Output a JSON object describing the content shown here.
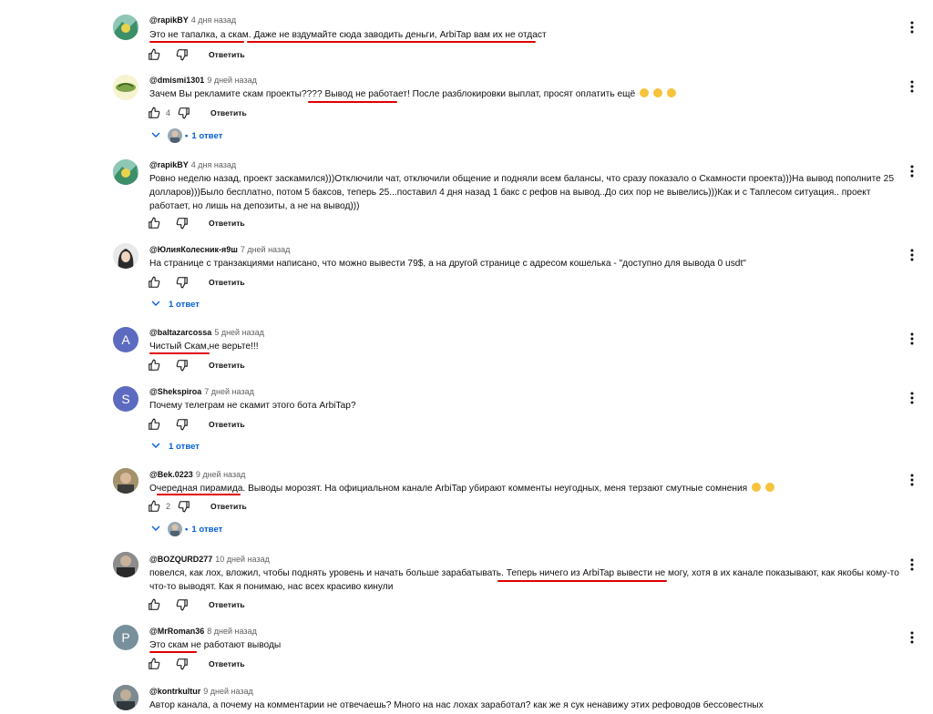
{
  "ui": {
    "reply_label": "Ответить"
  },
  "comments": [
    {
      "author": "@rapikBY",
      "time": "4 дня назад",
      "text": "Это не тапалка, а скам. Даже не вздумайте сюда заводить деньги, ArbiTap вам их не отдаст",
      "likes": "",
      "replies": ""
    },
    {
      "author": "@dmismi1301",
      "time": "9 дней назад",
      "text": "Зачем Вы рекламите скам проекты???? Вывод не работает! После разблокировки выплат, просят оплатить ещё",
      "likes": "4",
      "replies": "1 ответ"
    },
    {
      "author": "@rapikBY",
      "time": "4 дня назад",
      "text": "Ровно неделю назад, проект заскамился)))Отключили чат, отключили общение и подняли всем балансы, что сразу показало о Скамности проекта)))На вывод пополните 25 долларов)))Было бесплатно, потом 5 баксов, теперь 25...поставил 4 дня назад 1 бакс с рефов на вывод..До сих пор не вывелись)))Как и с Таплесом ситуация.. проект работает, но лишь на депозиты, а не на вывод)))",
      "likes": "",
      "replies": ""
    },
    {
      "author": "@ЮлияКолесник-я9ш",
      "time": "7 дней назад",
      "text": "На странице с транзакциями написано, что можно вывести 79$, а на другой странице с адресом кошелька - \"доступно для вывода 0 usdt\"",
      "likes": "",
      "replies": "1 ответ"
    },
    {
      "author": "@baltazarcossa",
      "time": "5 дней назад",
      "avatar_letter": "A",
      "text": "Чистый Скам,не верьте!!!",
      "likes": "",
      "replies": ""
    },
    {
      "author": "@Shekspiroa",
      "time": "7 дней назад",
      "avatar_letter": "S",
      "text": "Почему телеграм не скамит этого бота ArbiTap?",
      "likes": "",
      "replies": "1 ответ"
    },
    {
      "author": "@Bek.0223",
      "time": "9 дней назад",
      "text": "Очередная пирамида. Выводы морозят. На официальном канале ArbiTap убирают комменты неугодных, меня терзают смутные сомнения",
      "likes": "2",
      "replies": "1 ответ"
    },
    {
      "author": "@BOZQURD277",
      "time": "10 дней назад",
      "text": "повелся, как лох, вложил, чтобы поднять уровень и начать больше зарабатывать. Теперь ничего из ArbiTap вывести не могу, хотя в их канале показывают, как якобы кому-то что-то выводят. Как я понимаю, нас всех красиво кинули",
      "likes": "",
      "replies": ""
    },
    {
      "author": "@MrRoman36",
      "time": "8 дней назад",
      "avatar_letter": "P",
      "text": "Это скам не работают выводы",
      "likes": "",
      "replies": ""
    },
    {
      "author": "@kontrkultur",
      "time": "9 дней назад",
      "text": "Автор канала, а почему на комментарии не отвечаешь? Много на нас лохах заработал? как же я сук ненавижу этих рефоводов бессовестных",
      "likes": "",
      "replies": ""
    }
  ],
  "colors": {
    "link_blue": "#065fd4",
    "underline_red": "#e00000",
    "avatar_a": "#5c6bc0",
    "avatar_s": "#5c6bc0",
    "avatar_p": "#78909c"
  }
}
